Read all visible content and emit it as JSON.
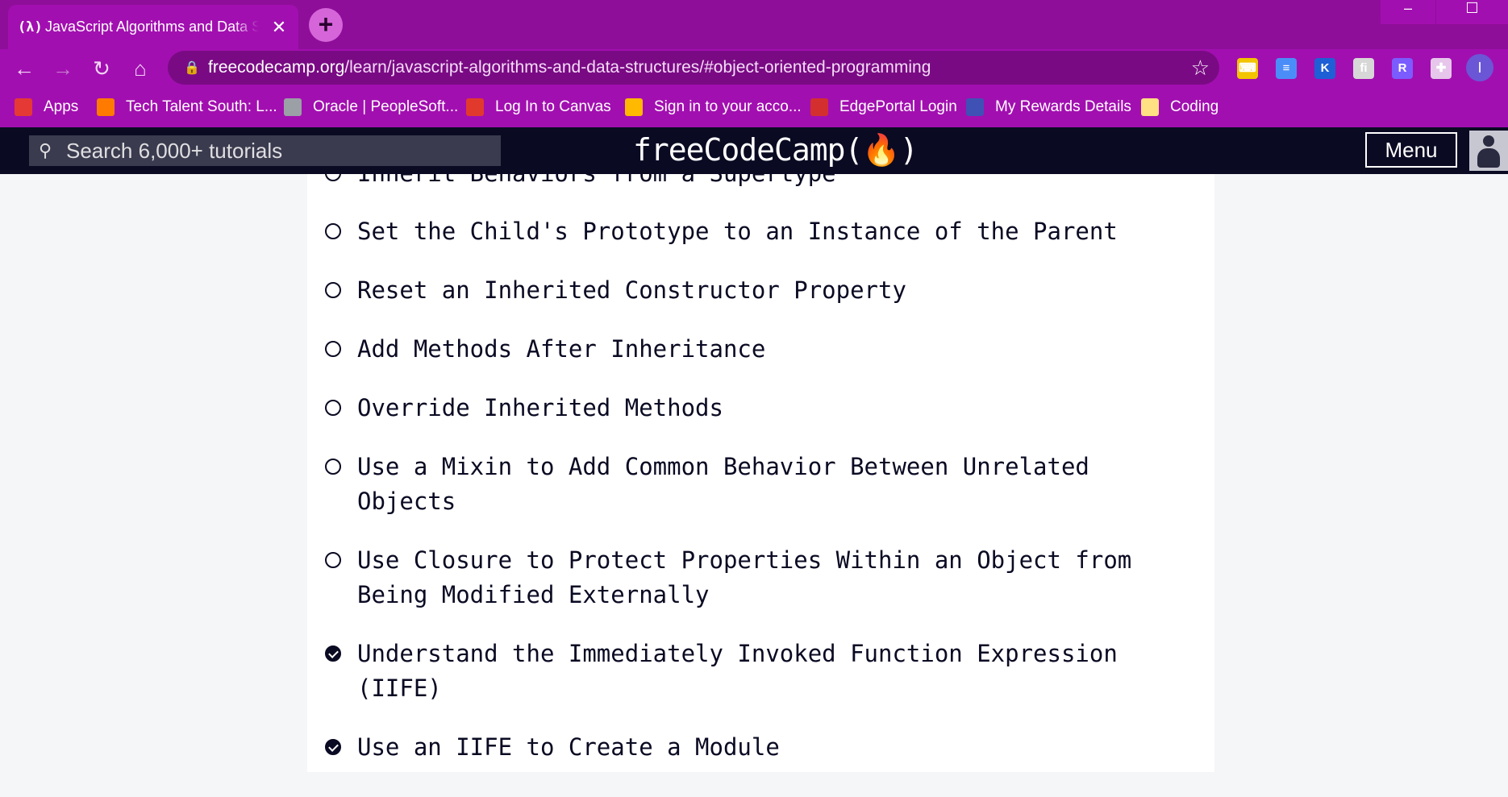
{
  "browser": {
    "tab": {
      "favicon_text": "(λ)",
      "title": "JavaScript Algorithms and Data Structures"
    },
    "window_controls": {
      "minimize": "–",
      "maximize": "☐"
    },
    "toolbar": {
      "url_domain": "freecodecamp.org",
      "url_path": "/learn/javascript-algorithms-and-data-structures/#object-oriented-programming"
    },
    "extensions": [
      {
        "icon": "keyboard-icon",
        "label": "⌨",
        "color": "#f2c500"
      },
      {
        "icon": "docs-icon",
        "label": "≡",
        "color": "#4b8df8"
      },
      {
        "icon": "k-icon",
        "label": "K",
        "color": "#1f5fd6"
      },
      {
        "icon": "readiy-icon",
        "label": "fi",
        "color": "#d7d7d7"
      },
      {
        "icon": "r-icon",
        "label": "R",
        "color": "#7b5cff"
      },
      {
        "icon": "puzzle-icon",
        "label": "✚",
        "color": "#e6c6ea"
      }
    ],
    "profile_initial": "I",
    "bookmarks": [
      {
        "label": "Apps",
        "icon": "apps-grid-icon"
      },
      {
        "label": "Tech Talent South: L...",
        "icon": "tts-icon"
      },
      {
        "label": "Oracle | PeopleSoft...",
        "icon": "globe-icon"
      },
      {
        "label": "Log In to Canvas",
        "icon": "canvas-icon"
      },
      {
        "label": "Sign in to your acco...",
        "icon": "microsoft-icon"
      },
      {
        "label": "EdgePortal Login",
        "icon": "edgeportal-icon"
      },
      {
        "label": "My Rewards Details",
        "icon": "citi-icon"
      },
      {
        "label": "Coding",
        "icon": "folder-icon"
      }
    ]
  },
  "fcc_nav": {
    "search_placeholder": "Search 6,000+ tutorials",
    "brand": "freeCodeCamp(🔥)",
    "menu_label": "Menu"
  },
  "lessons": [
    {
      "title": "Inherit Behaviors from a Supertype",
      "completed": false
    },
    {
      "title": "Set the Child's Prototype to an Instance of the Parent",
      "completed": false
    },
    {
      "title": "Reset an Inherited Constructor Property",
      "completed": false
    },
    {
      "title": "Add Methods After Inheritance",
      "completed": false
    },
    {
      "title": "Override Inherited Methods",
      "completed": false
    },
    {
      "title": "Use a Mixin to Add Common Behavior Between Unrelated Objects",
      "completed": false
    },
    {
      "title": "Use Closure to Protect Properties Within an Object from Being Modified Externally",
      "completed": false
    },
    {
      "title": "Understand the Immediately Invoked Function Expression (IIFE)",
      "completed": true
    },
    {
      "title": "Use an IIFE to Create a Module",
      "completed": true
    }
  ]
}
